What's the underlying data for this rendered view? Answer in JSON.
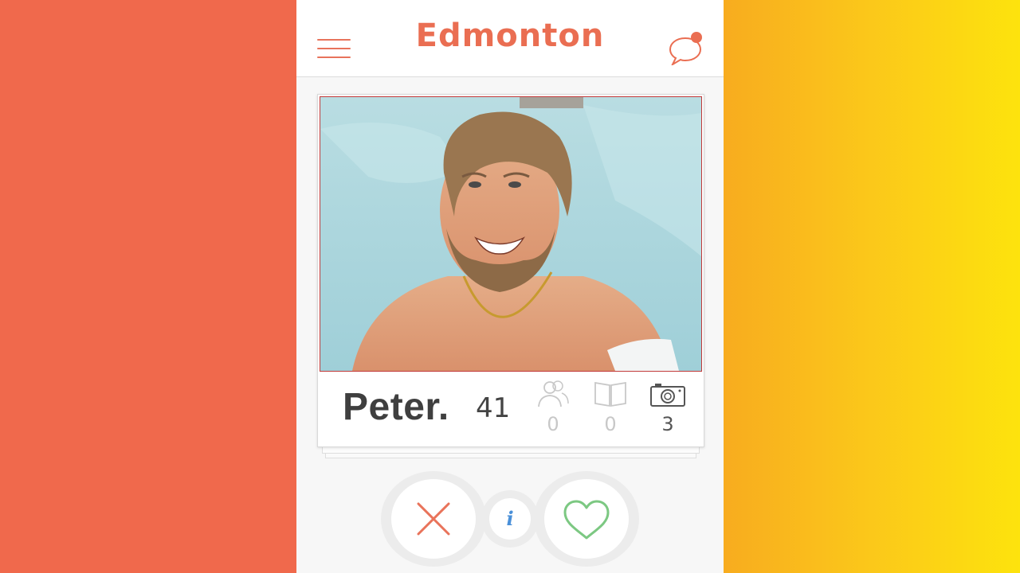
{
  "app": {
    "title": "Edmonton"
  },
  "profile": {
    "name": "Peter.",
    "age": "41"
  },
  "stats": [
    {
      "icon": "friends-icon",
      "value": "0",
      "color": "#c8c8c8"
    },
    {
      "icon": "interests-icon",
      "value": "0",
      "color": "#c8c8c8"
    },
    {
      "icon": "camera-icon",
      "value": "3",
      "color": "#555555"
    }
  ],
  "actions": {
    "info_label": "i"
  },
  "colors": {
    "left_panel": "#f0694c",
    "right_panel_start": "#f8ac1f",
    "right_panel_end": "#fde30d",
    "accent": "#ea6e52",
    "like": "#7cc882",
    "info": "#4a90d9"
  }
}
